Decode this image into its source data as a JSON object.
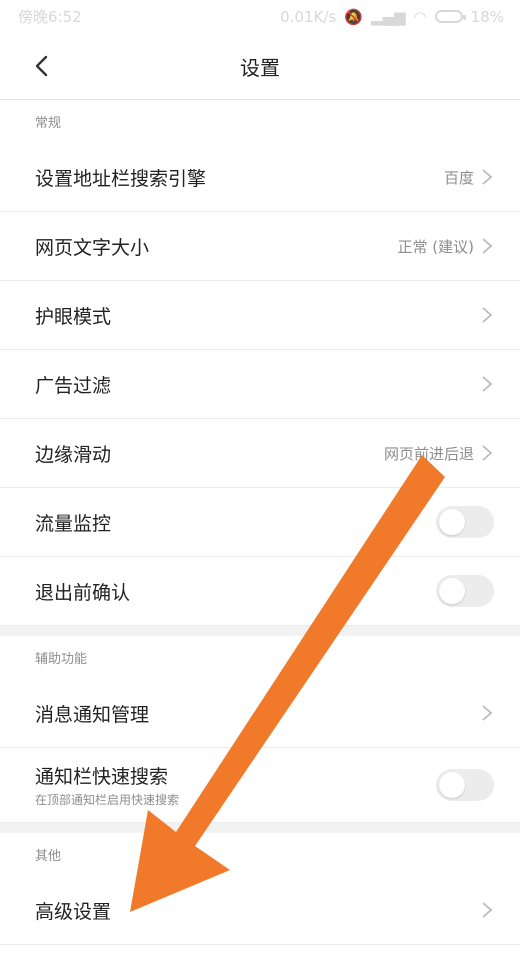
{
  "status": {
    "time": "傍晚6:52",
    "net": "0.01K/s",
    "battery": "18%"
  },
  "header": {
    "title": "设置"
  },
  "sections": [
    {
      "title": "常规"
    },
    {
      "title": "辅助功能"
    },
    {
      "title": "其他"
    }
  ],
  "rows": {
    "search_engine": {
      "label": "设置地址栏搜索引擎",
      "value": "百度"
    },
    "font_size": {
      "label": "网页文字大小",
      "value": "正常 (建议)"
    },
    "eye_mode": {
      "label": "护眼模式"
    },
    "ad_filter": {
      "label": "广告过滤"
    },
    "edge_swipe": {
      "label": "边缘滑动",
      "value": "网页前进后退"
    },
    "data_monitor": {
      "label": "流量监控",
      "on": false
    },
    "exit_confirm": {
      "label": "退出前确认",
      "on": false
    },
    "notif_manage": {
      "label": "消息通知管理"
    },
    "quick_search": {
      "label": "通知栏快速搜索",
      "sub": "在顶部通知栏启用快速搜索",
      "on": false
    },
    "advanced": {
      "label": "高级设置"
    }
  },
  "colors": {
    "annotation_arrow": "#f07a2a"
  }
}
